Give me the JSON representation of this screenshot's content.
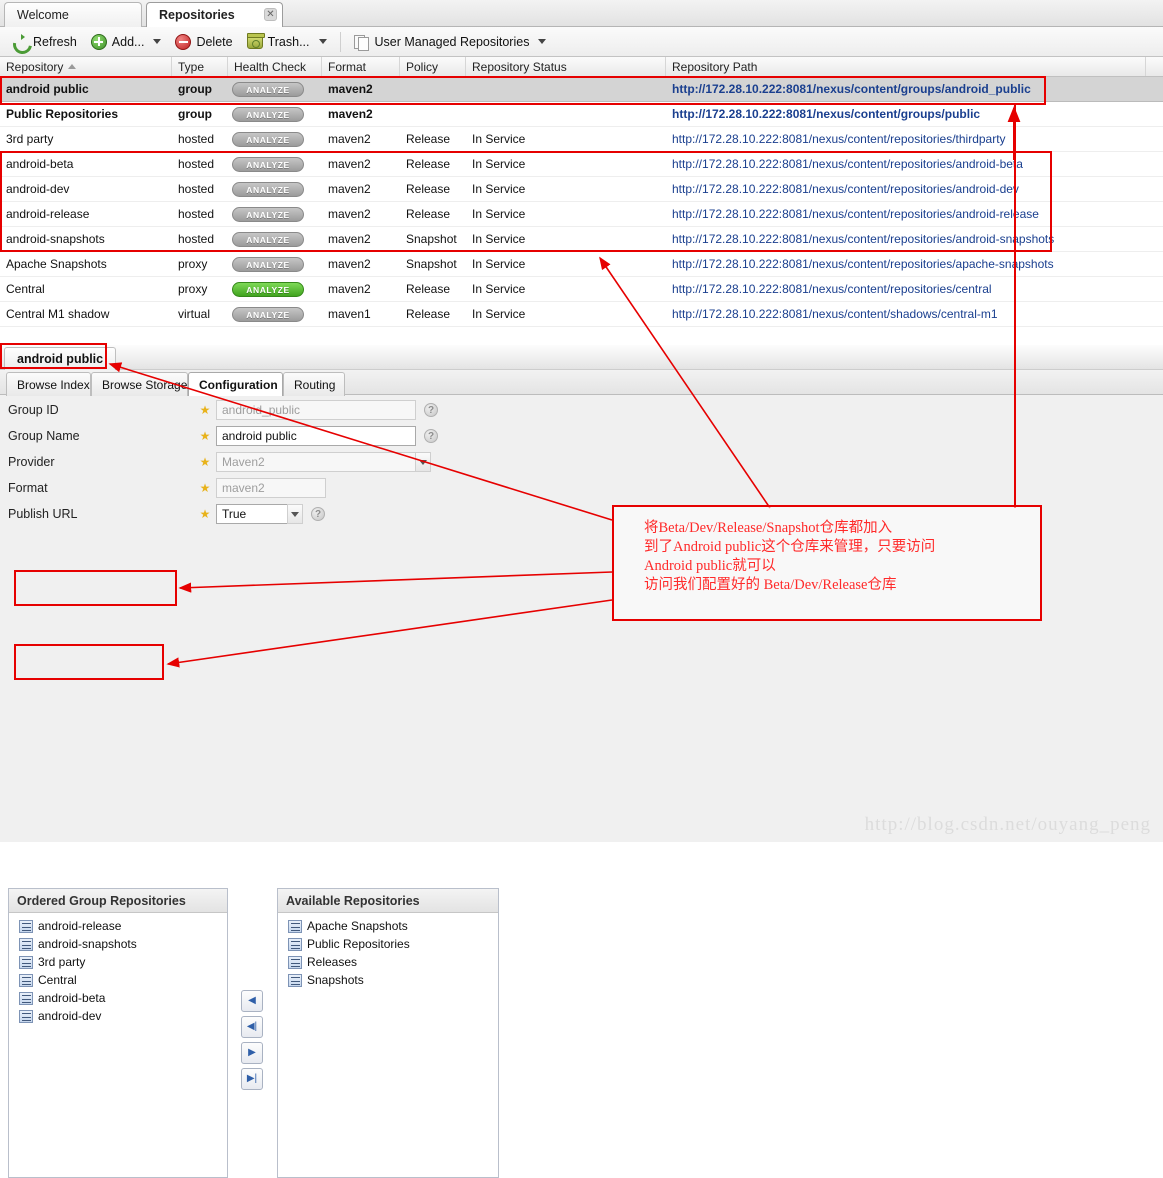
{
  "window_tabs": [
    {
      "label": "Welcome",
      "active": false,
      "closable": false
    },
    {
      "label": "Repositories",
      "active": true,
      "closable": true,
      "close_glyph": "✕"
    }
  ],
  "toolbar": {
    "refresh": {
      "label": "Refresh",
      "icon": "refresh-icon"
    },
    "add": {
      "label": "Add...",
      "icon": "add-circle-icon",
      "has_menu": true
    },
    "delete": {
      "label": "Delete",
      "icon": "delete-circle-icon"
    },
    "trash": {
      "label": "Trash...",
      "icon": "trash-icon",
      "has_menu": true
    },
    "filter": {
      "label": "User Managed Repositories",
      "icon": "pages-icon",
      "has_menu": true
    }
  },
  "grid": {
    "columns": [
      "Repository",
      "Type",
      "Health Check",
      "Format",
      "Policy",
      "Repository Status",
      "Repository Path"
    ],
    "sorted_column": "Repository",
    "sort_direction": "asc",
    "analyze_label": "ANALYZE",
    "rows": [
      {
        "repository": "android public",
        "type": "group",
        "health": "grey",
        "format": "maven2",
        "policy": "",
        "status": "",
        "path": "http://172.28.10.222:8081/nexus/content/groups/android_public",
        "selected": true,
        "bold": true
      },
      {
        "repository": "Public Repositories",
        "type": "group",
        "health": "grey",
        "format": "maven2",
        "policy": "",
        "status": "",
        "path": "http://172.28.10.222:8081/nexus/content/groups/public",
        "selected": false,
        "bold": true
      },
      {
        "repository": "3rd party",
        "type": "hosted",
        "health": "grey",
        "format": "maven2",
        "policy": "Release",
        "status": "In Service",
        "path": "http://172.28.10.222:8081/nexus/content/repositories/thirdparty",
        "selected": false,
        "bold": false
      },
      {
        "repository": "android-beta",
        "type": "hosted",
        "health": "grey",
        "format": "maven2",
        "policy": "Release",
        "status": "In Service",
        "path": "http://172.28.10.222:8081/nexus/content/repositories/android-beta",
        "selected": false,
        "bold": false
      },
      {
        "repository": "android-dev",
        "type": "hosted",
        "health": "grey",
        "format": "maven2",
        "policy": "Release",
        "status": "In Service",
        "path": "http://172.28.10.222:8081/nexus/content/repositories/android-dev",
        "selected": false,
        "bold": false
      },
      {
        "repository": "android-release",
        "type": "hosted",
        "health": "grey",
        "format": "maven2",
        "policy": "Release",
        "status": "In Service",
        "path": "http://172.28.10.222:8081/nexus/content/repositories/android-release",
        "selected": false,
        "bold": false
      },
      {
        "repository": "android-snapshots",
        "type": "hosted",
        "health": "grey",
        "format": "maven2",
        "policy": "Snapshot",
        "status": "In Service",
        "path": "http://172.28.10.222:8081/nexus/content/repositories/android-snapshots",
        "selected": false,
        "bold": false
      },
      {
        "repository": "Apache Snapshots",
        "type": "proxy",
        "health": "grey",
        "format": "maven2",
        "policy": "Snapshot",
        "status": "In Service",
        "path": "http://172.28.10.222:8081/nexus/content/repositories/apache-snapshots",
        "selected": false,
        "bold": false
      },
      {
        "repository": "Central",
        "type": "proxy",
        "health": "green",
        "format": "maven2",
        "policy": "Release",
        "status": "In Service",
        "path": "http://172.28.10.222:8081/nexus/content/repositories/central",
        "selected": false,
        "bold": false
      },
      {
        "repository": "Central M1 shadow",
        "type": "virtual",
        "health": "grey",
        "format": "maven1",
        "policy": "Release",
        "status": "In Service",
        "path": "http://172.28.10.222:8081/nexus/content/shadows/central-m1",
        "selected": false,
        "bold": false
      }
    ]
  },
  "detail": {
    "title": "android public",
    "tabs": [
      {
        "label": "Browse Index",
        "active": false
      },
      {
        "label": "Browse Storage",
        "active": false
      },
      {
        "label": "Configuration",
        "active": true
      },
      {
        "label": "Routing",
        "active": false
      }
    ],
    "fields": [
      {
        "label": "Group ID",
        "value": "android_public",
        "placeholder": "android_public",
        "kind": "text",
        "required": true,
        "readonly": true,
        "help": true,
        "width": "w200"
      },
      {
        "label": "Group Name",
        "value": "android public",
        "placeholder": "",
        "kind": "text",
        "required": true,
        "readonly": false,
        "help": true,
        "width": "w200"
      },
      {
        "label": "Provider",
        "value": "Maven2",
        "placeholder": "Maven2",
        "kind": "select",
        "required": true,
        "readonly": true,
        "help": false,
        "width": "w200"
      },
      {
        "label": "Format",
        "value": "maven2",
        "placeholder": "maven2",
        "kind": "text",
        "required": true,
        "readonly": true,
        "help": false,
        "width": "w110"
      },
      {
        "label": "Publish URL",
        "value": "True",
        "placeholder": "",
        "kind": "select",
        "required": true,
        "readonly": false,
        "help": true,
        "width": "w80"
      }
    ],
    "star_glyph": "★",
    "help_glyph": "?",
    "ordered_group": {
      "title": "Ordered Group Repositories",
      "items": [
        "android-release",
        "android-snapshots",
        "3rd party",
        "Central",
        "android-beta",
        "android-dev"
      ]
    },
    "available": {
      "title": "Available Repositories",
      "items": [
        "Apache Snapshots",
        "Public Repositories",
        "Releases",
        "Snapshots"
      ]
    },
    "transfer_buttons": [
      {
        "name": "move-left-button",
        "glyph": "◀"
      },
      {
        "name": "move-all-left-button",
        "glyph": "◀|"
      },
      {
        "name": "move-right-button",
        "glyph": "▶"
      },
      {
        "name": "move-all-right-button",
        "glyph": "▶|"
      }
    ]
  },
  "annotation": {
    "note_lines": [
      "将Beta/Dev/Release/Snapshot仓库都加入",
      "到了Android public这个仓库来管理，只要访问",
      "Android public就可以",
      "访问我们配置好的 Beta/Dev/Release仓库"
    ],
    "color": "#e60000"
  },
  "watermark": "http://blog.csdn.net/ouyang_peng"
}
